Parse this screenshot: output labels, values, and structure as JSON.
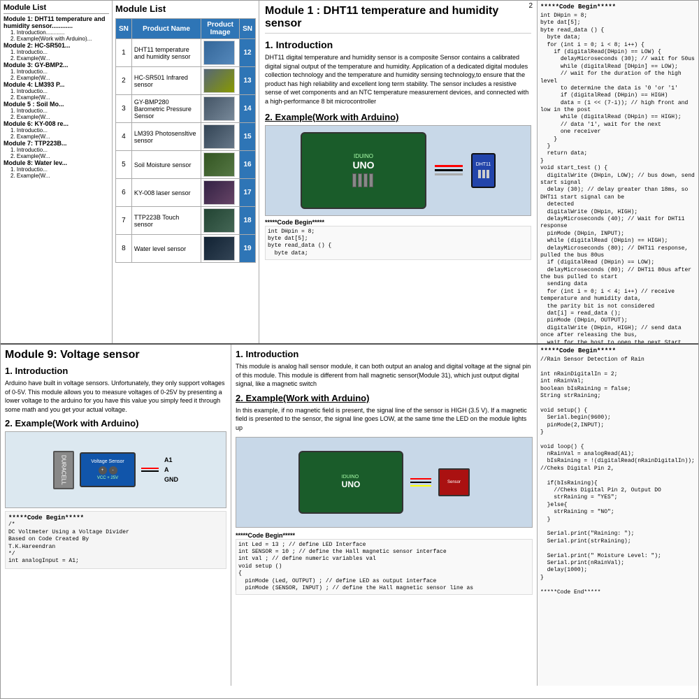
{
  "page": {
    "number": "2",
    "top_section": {
      "sidebar": {
        "title": "Module List",
        "modules": [
          {
            "title": "Module 1: DHT11 temperature and humidity sensor...",
            "subs": [
              "1. Introduction............",
              "2. Example(Work with Arduino)..........."
            ]
          },
          {
            "title": "Module 2: HC-SR501...",
            "subs": [
              "1. Introductio...",
              "2. Example(W..."
            ]
          },
          {
            "title": "Module 3: GY-BMP2...",
            "subs": [
              "1. Introductio...",
              "2. Example(W..."
            ]
          },
          {
            "title": "Module 4: LM393 P...",
            "subs": [
              "1. Introductio...",
              "2. Example(W..."
            ]
          },
          {
            "title": "Module 5  : Soil Mo...",
            "subs": [
              "1. Introductio...",
              "2. Example(W..."
            ]
          },
          {
            "title": "Module 6: KY-008 re...",
            "subs": [
              "1. Introductio...",
              "2. Example(W..."
            ]
          },
          {
            "title": "Module 7: TTP223B...",
            "subs": [
              "1. Introductio...",
              "2. Example(W..."
            ]
          },
          {
            "title": "Module 8: Water lev...",
            "subs": [
              "1. Introductio...",
              "2. Example(W..."
            ]
          }
        ]
      },
      "module_list_table": {
        "title": "Module List",
        "headers": [
          "SN",
          "Product Name",
          "Product Image",
          "SN"
        ],
        "rows": [
          {
            "sn": "1",
            "name": "DHT11 temperature and humidity sensor",
            "img_class": "img-dht11",
            "sn2": "12"
          },
          {
            "sn": "2",
            "name": "HC-SR501 Infrared sensor",
            "img_class": "img-hcsr",
            "sn2": "13"
          },
          {
            "sn": "3",
            "name": "GY-BMP280 Barometric Pressure Sensor",
            "img_class": "img-bmp",
            "sn2": "14"
          },
          {
            "sn": "4",
            "name": "LM393 Photosensltive sensor",
            "img_class": "img-lm393",
            "sn2": "15"
          },
          {
            "sn": "5",
            "name": "Soil Moisture sensor",
            "img_class": "img-soil",
            "sn2": "16"
          },
          {
            "sn": "6",
            "name": "KY-008 laser sensor",
            "img_class": "img-ky008",
            "sn2": "17"
          },
          {
            "sn": "7",
            "name": "TTP223B Touch sensor",
            "img_class": "img-ttp",
            "sn2": "18"
          },
          {
            "sn": "8",
            "name": "Water level sensor",
            "img_class": "img-water",
            "sn2": "19"
          }
        ]
      },
      "main_content": {
        "heading": "Module 1 : DHT11 temperature and humidity sensor",
        "intro_title": "1. Introduction",
        "intro_text": "DHT11 digital temperature and humidity sensor is a composite Sensor contains a calibrated digital signal output of the temperature and humidity. Application of a dedicated digital modules collection technology and the temperature and humidity sensing technology,to ensure that the product has high reliability and excellent long term stability. The sensor includes a resistive sense of wet components and an NTC temperature measurement devices, and connected with a high-performance 8 bit microcontroller",
        "example_title": "2. Example(Work with Arduino)",
        "code_begin_label": "*****Code Begin*****",
        "code_snippet": "int DHpin = 8;\nbyte dat [5];\nbyte read_data () {\n  byte data;\n  for (int i = 0; i < 8; i++) {\n    if (digitalRead (DHpin) == LOW) {\n      delayMicroseconds (30); // wait for 50us\n      while (digitalRead [DHpin] == LOW); // wait for the duration of the high level\n      to determine the data is '0 'or '1'\n      if (digitalRead (DHpin) == HIGH)\n      data = (1 << (7-i)); // high front and low in the post\n      while (digitalRead (DHpin) == HIGH); // data '1', wait for the next one receiver\n    }\n  }\n  return data;\n}"
      },
      "code_panel": {
        "title": "*****Code Begin*****",
        "code": "int DHpin = 8;\nbyte dat[5];\nbyte read_data () {\n  byte data;\n  for (int i = 0; i < 8; i++) {\n    if (digitalRead(DHpin) == LOW) {\n      delayMicroseconds (30); // wait for 50us\n      while (digitalRead [DHpin] == LOW);\n      // wait for the duration of the high level\n      to determine the data is '0 'or '1'\n      if (digitalRead (DHpin) == HIGH)\n      data = (1 << (7-i)); // high front and low in the post\n      while (digitalRead (DHpin) == HIGH);\n      // data '1', wait for the next\n      one receiver\n    }\n  }\n  return data;\n}\nvoid start_test () {\n  digitalWrite (DHpin, LOW); // bus down, send start signal\n  delay (30); // delay greater than 18ms, so DHT11 start signal can be\n  detected\n  digitalWrite (DHpin, HIGH);\n  delayMicroseconds (40); // Wait for DHT11 response\n  pinMode (DHpin, INPUT);\n  while (digitalRead (DHpin) == HIGH);\n  delayMicroseconds (80); // DHT11 response, pulled the bus 80us\n  if (digitalRead (DHpin) == LOW);\n  delayMicroseconds (80); // DHT11 80us after the bus pulled to start\n  sending data\n  for (int i = 0; i < 4; i++) // receive temperature and humidity data,\n  the parity bit is not considered\n  dat[i] = read_data ();\n  pinMode (DHpin, OUTPUT);\n  digitalWrite (DHpin, HIGH); // send data once after releasing the bus,\n  wait for the host to open the next Start signal\n}"
      }
    },
    "bottom_section": {
      "left": {
        "module_title": "Module 9: Voltage sensor",
        "intro_title": "1. Introduction",
        "intro_text": "Arduino have built in voltage sensors. Unfortunately, they only support voltages of 0-5V. This module allows you to measure voltages of 0-25V by presenting a lower voltage to the arduino for you have this value you simply feed it through some math and you get your actual voltage.",
        "example_title": "2. Example(Work with Arduino)",
        "code_title": "*****Code Begin*****",
        "code_text": "/*\nDC Voltmeter Using a Voltage Divider\nBased on Code Created By\nT.K.Hareendran\n*/\nint analogInput = A1;"
      },
      "middle": {
        "intro_title": "1. Introduction",
        "intro_text": "This module is analog hall sensor module, it can both output an analog and digital voltage at the signal pin of this module. This module is different from hall magnetic sensor(Module 31), which just output digital signal, like a magnetic switch",
        "example_title": "2. Example(Work with Arduino)",
        "example_text": "In this example, if no magnetic field is present, the signal line of the sensor is HIGH (3.5 V). If a magnetic field is presented to the sensor, the signal line goes LOW, at the same time the LED on the module lights up",
        "code_title": "*****Code Begin*****",
        "code_text": "int Led = 13 ; // define LED Interface\nint SENSOR = 10 ; // define the Hall magnetic sensor interface\nint val ; // define numeric variables val\nvoid setup ()\n{\n  pinMode (Led, OUTPUT) ; // define LED as output interface\n  pinMode (SENSOR, INPUT) ; // define the Hall magnetic sensor line as"
      },
      "right_code": {
        "title": "*****Code Begin*****",
        "code": "//Rain Sensor Detection of Rain\n\nint nRainDigitalIn = 2;\nint nRainVal;\nboolean bIsRaining = false;\nString strRaining;\n\nvoid setup() {\n  Serial.begin(9600);\n  pinMode(2,INPUT);\n}\n\nvoid loop() {\n  nRainVal = analogRead(A1);\n  bIsRaining = !(digitalRead(nRainDigitalIn)); //Cheks Digital Pin 2,\n\n  if(bIsRaining){\n    //Cheks Digital Pin 2, Output DO\n    strRaining = \"YES\";\n  }else{\n    strRaining = \"NO\";\n  }\n\n  Serial.print(\"Raining: \");\n  Serial.print(strRaining);\n\n  Serial.print(\" Moisture Level: \");\n  Serial.print(nRainVal);\n  delay(1000);\n}\n\n*****Code End*****"
      }
    }
  }
}
